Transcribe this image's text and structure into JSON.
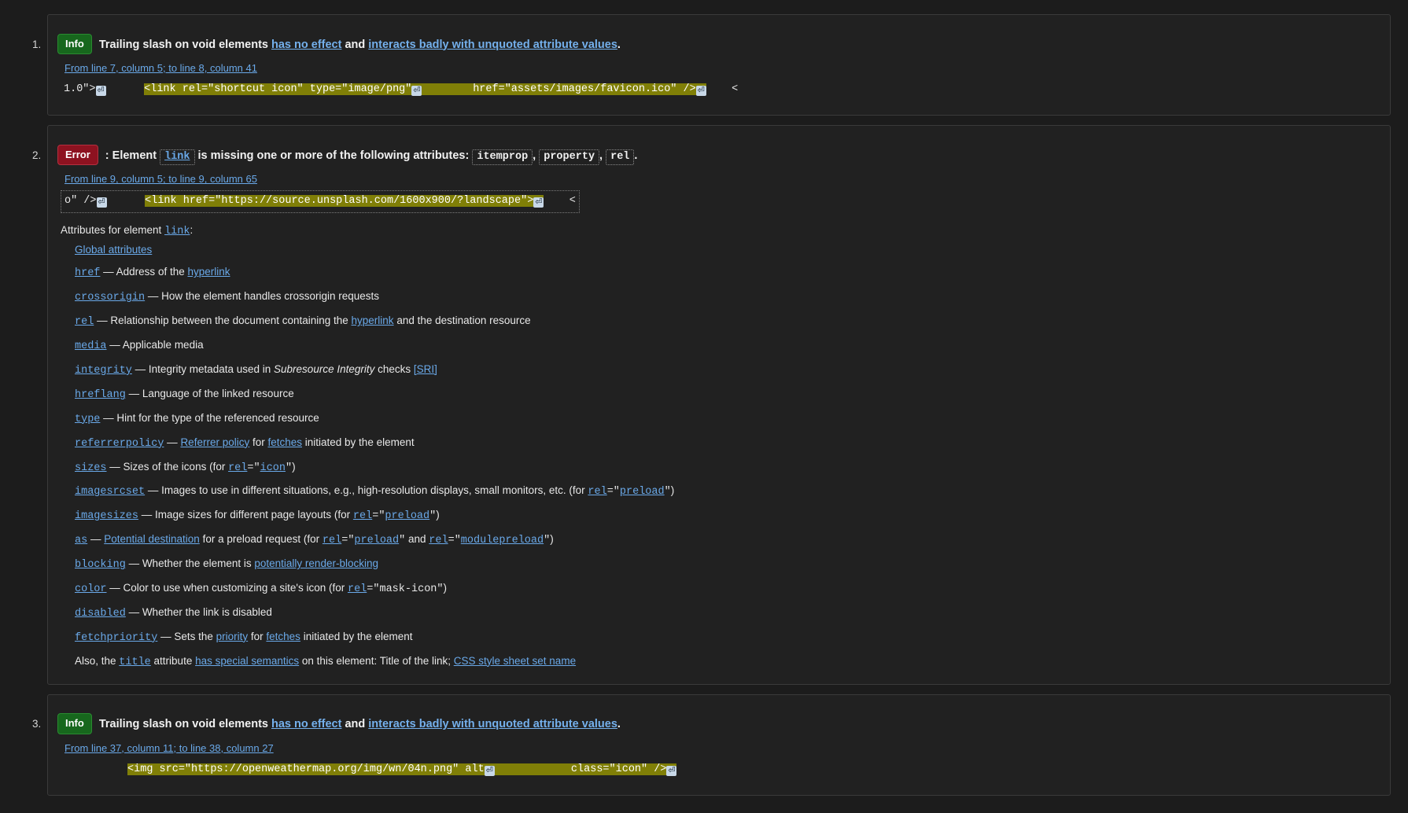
{
  "icons": {
    "carriage_return": "⏎"
  },
  "colors": {
    "page_bg": "#1c1c1c",
    "box_bg": "#212121",
    "box_border": "#3a3a3a",
    "info_badge": "#17671d",
    "error_badge": "#8d1220",
    "link": "#6aa9e9",
    "highlight": "#807f07"
  },
  "messages": [
    {
      "index": "1",
      "badge": "Info",
      "badge_type": "info",
      "headline": {
        "before": "Trailing slash on void elements ",
        "link1": "has no effect",
        "mid": " and ",
        "link2": "interacts badly with unquoted attribute values",
        "after": "."
      },
      "location": "From line 7, column 5; to line 8, column 41",
      "extract": {
        "bordered": false,
        "pre": "1.0\">",
        "pre_cr": true,
        "gap1": "      ",
        "highlight": "<link rel=\"shortcut icon\" type=\"image/png\"",
        "hl_cr": true,
        "gap2": "        ",
        "highlight2": "href=\"assets/images/favicon.ico\" />",
        "hl2_cr": true,
        "post": "    <"
      }
    },
    {
      "index": "2",
      "badge": "Error",
      "badge_type": "error",
      "headline": {
        "lead": "Error",
        "colon": ": ",
        "t1": "Element ",
        "chip1": "link",
        "t2": " is missing one or more of the following attributes: ",
        "chip2": "itemprop",
        "sep1": ", ",
        "chip3": "property",
        "sep2": ", ",
        "chip4": "rel",
        "t3": "."
      },
      "location": "From line 9, column 5; to line 9, column 65",
      "extract": {
        "bordered": true,
        "pre": "o\" />",
        "pre_cr": true,
        "gap1": "      ",
        "highlight": "<link href=\"https://source.unsplash.com/1600x900/?landscape\">",
        "hl_cr": true,
        "post": "    <"
      },
      "attributes_intro": {
        "before": "Attributes for element ",
        "element": "link",
        "after": ":"
      },
      "attributes": [
        {
          "kind": "link-only",
          "name": "Global attributes"
        },
        {
          "kind": "attr",
          "name": "href",
          "parts": [
            {
              "t": "text",
              "v": " — Address of the "
            },
            {
              "t": "link",
              "v": "hyperlink"
            }
          ]
        },
        {
          "kind": "attr",
          "name": "crossorigin",
          "parts": [
            {
              "t": "text",
              "v": " — How the element handles crossorigin requests"
            }
          ]
        },
        {
          "kind": "attr",
          "name": "rel",
          "parts": [
            {
              "t": "text",
              "v": " — Relationship between the document containing the "
            },
            {
              "t": "link",
              "v": "hyperlink"
            },
            {
              "t": "text",
              "v": " and the destination resource"
            }
          ]
        },
        {
          "kind": "attr",
          "name": "media",
          "parts": [
            {
              "t": "text",
              "v": " — Applicable media"
            }
          ]
        },
        {
          "kind": "attr",
          "name": "integrity",
          "parts": [
            {
              "t": "text",
              "v": " — Integrity metadata used in "
            },
            {
              "t": "em",
              "v": "Subresource Integrity"
            },
            {
              "t": "text",
              "v": " checks "
            },
            {
              "t": "link",
              "v": "[SRI]"
            }
          ]
        },
        {
          "kind": "attr",
          "name": "hreflang",
          "parts": [
            {
              "t": "text",
              "v": " — Language of the linked resource"
            }
          ]
        },
        {
          "kind": "attr",
          "name": "type",
          "parts": [
            {
              "t": "text",
              "v": " — Hint for the type of the referenced resource"
            }
          ]
        },
        {
          "kind": "attr",
          "name": "referrerpolicy",
          "parts": [
            {
              "t": "text",
              "v": " — "
            },
            {
              "t": "link",
              "v": "Referrer policy"
            },
            {
              "t": "text",
              "v": " for "
            },
            {
              "t": "link",
              "v": "fetches"
            },
            {
              "t": "text",
              "v": " initiated by the element"
            }
          ]
        },
        {
          "kind": "attr",
          "name": "sizes",
          "parts": [
            {
              "t": "text",
              "v": " — Sizes of the icons (for "
            },
            {
              "t": "monolink",
              "v": "rel"
            },
            {
              "t": "mono",
              "v": "=\""
            },
            {
              "t": "monolink",
              "v": "icon"
            },
            {
              "t": "mono",
              "v": "\""
            },
            {
              "t": "text",
              "v": ")"
            }
          ]
        },
        {
          "kind": "attr",
          "name": "imagesrcset",
          "parts": [
            {
              "t": "text",
              "v": " — Images to use in different situations, e.g., high-resolution displays, small monitors, etc. (for "
            },
            {
              "t": "monolink",
              "v": "rel"
            },
            {
              "t": "mono",
              "v": "=\""
            },
            {
              "t": "monolink",
              "v": "preload"
            },
            {
              "t": "mono",
              "v": "\""
            },
            {
              "t": "text",
              "v": ")"
            }
          ]
        },
        {
          "kind": "attr",
          "name": "imagesizes",
          "parts": [
            {
              "t": "text",
              "v": " — Image sizes for different page layouts (for "
            },
            {
              "t": "monolink",
              "v": "rel"
            },
            {
              "t": "mono",
              "v": "=\""
            },
            {
              "t": "monolink",
              "v": "preload"
            },
            {
              "t": "mono",
              "v": "\""
            },
            {
              "t": "text",
              "v": ")"
            }
          ]
        },
        {
          "kind": "attr",
          "name": "as",
          "parts": [
            {
              "t": "text",
              "v": " — "
            },
            {
              "t": "link",
              "v": "Potential destination"
            },
            {
              "t": "text",
              "v": " for a preload request (for "
            },
            {
              "t": "monolink",
              "v": "rel"
            },
            {
              "t": "mono",
              "v": "=\""
            },
            {
              "t": "monolink",
              "v": "preload"
            },
            {
              "t": "mono",
              "v": "\""
            },
            {
              "t": "text",
              "v": " and "
            },
            {
              "t": "monolink",
              "v": "rel"
            },
            {
              "t": "mono",
              "v": "=\""
            },
            {
              "t": "monolink",
              "v": "modulepreload"
            },
            {
              "t": "mono",
              "v": "\""
            },
            {
              "t": "text",
              "v": ")"
            }
          ]
        },
        {
          "kind": "attr",
          "name": "blocking",
          "parts": [
            {
              "t": "text",
              "v": " — Whether the element is "
            },
            {
              "t": "link",
              "v": "potentially render-blocking"
            }
          ]
        },
        {
          "kind": "attr",
          "name": "color",
          "parts": [
            {
              "t": "text",
              "v": " — Color to use when customizing a site's icon (for "
            },
            {
              "t": "monolink",
              "v": "rel"
            },
            {
              "t": "mono",
              "v": "=\"mask-icon\""
            },
            {
              "t": "text",
              "v": ")"
            }
          ]
        },
        {
          "kind": "attr",
          "name": "disabled",
          "parts": [
            {
              "t": "text",
              "v": " — Whether the link is disabled"
            }
          ]
        },
        {
          "kind": "attr",
          "name": "fetchpriority",
          "parts": [
            {
              "t": "text",
              "v": " — Sets the "
            },
            {
              "t": "link",
              "v": "priority"
            },
            {
              "t": "text",
              "v": " for "
            },
            {
              "t": "link",
              "v": "fetches"
            },
            {
              "t": "text",
              "v": " initiated by the element"
            }
          ]
        },
        {
          "kind": "plain",
          "parts": [
            {
              "t": "text",
              "v": "Also, the "
            },
            {
              "t": "monolink",
              "v": "title"
            },
            {
              "t": "text",
              "v": " attribute "
            },
            {
              "t": "link",
              "v": "has special semantics"
            },
            {
              "t": "text",
              "v": " on this element: Title of the link; "
            },
            {
              "t": "link",
              "v": "CSS style sheet set name"
            }
          ]
        }
      ]
    },
    {
      "index": "3",
      "badge": "Info",
      "badge_type": "info",
      "headline": {
        "before": "Trailing slash on void elements ",
        "link1": "has no effect",
        "mid": " and ",
        "link2": "interacts badly with unquoted attribute values",
        "after": "."
      },
      "location": "From line 37, column 11; to line 38, column 27",
      "extract": {
        "bordered": false,
        "pre": "",
        "pre_cr": false,
        "gap1": "          ",
        "highlight": "<img src=\"https://openweathermap.org/img/wn/04n.png\" alt",
        "hl_cr": true,
        "gap2": "            ",
        "highlight2": "class=\"icon\" />",
        "hl2_cr": true,
        "post": ""
      }
    }
  ]
}
